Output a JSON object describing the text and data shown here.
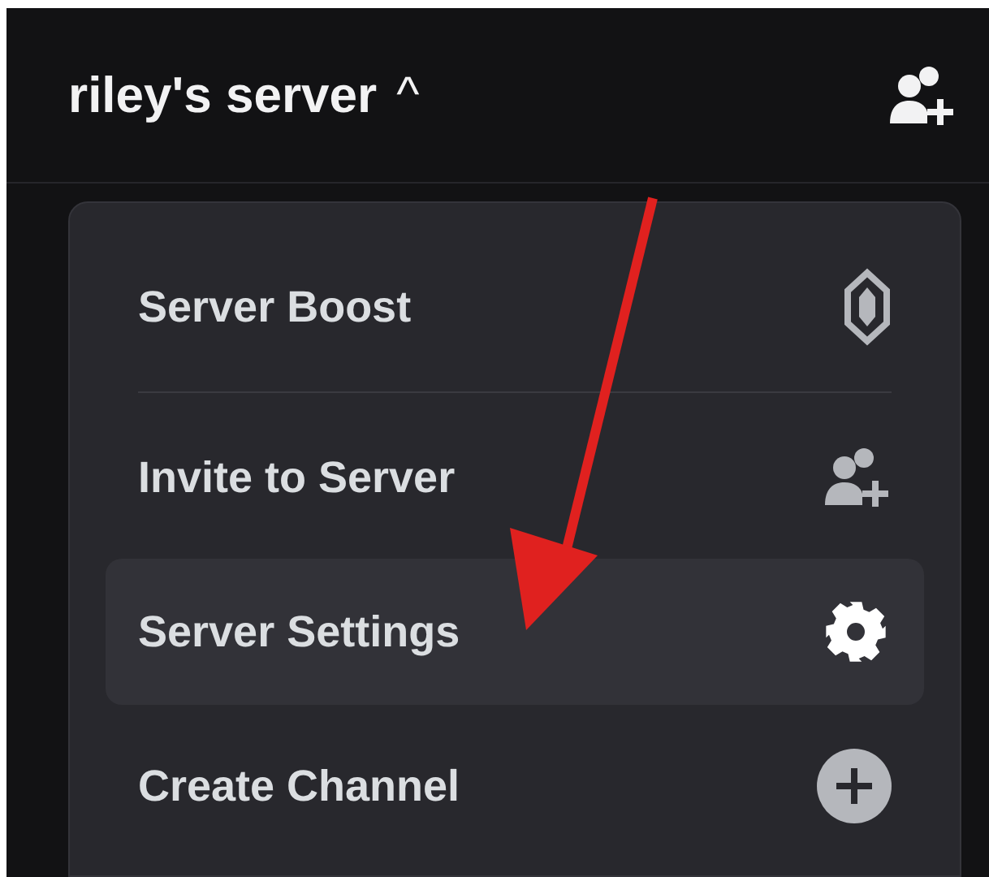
{
  "header": {
    "title": "riley's server",
    "caret": "^"
  },
  "menu": [
    {
      "kind": "item",
      "label": "Server Boost",
      "selected": false
    },
    {
      "kind": "separator"
    },
    {
      "kind": "item",
      "label": "Invite to Server",
      "selected": false
    },
    {
      "kind": "item",
      "label": "Server Settings",
      "selected": true
    },
    {
      "kind": "item",
      "label": "Create Channel",
      "selected": false
    }
  ]
}
